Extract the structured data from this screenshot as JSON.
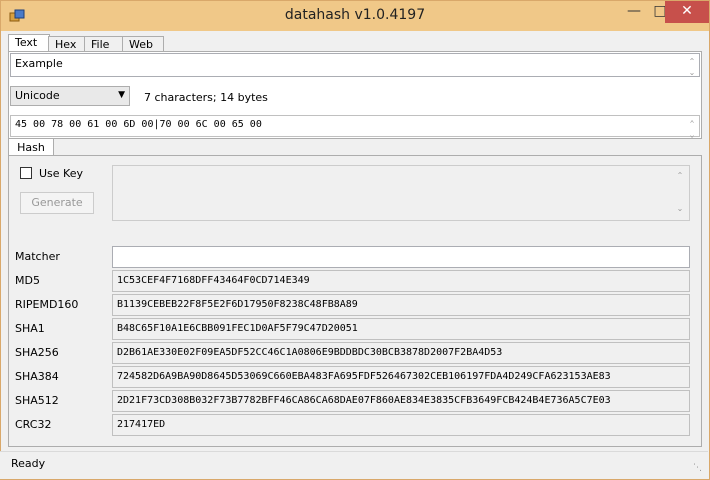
{
  "window": {
    "title": "datahash v1.0.4197"
  },
  "tabs": [
    "Text",
    "Hex",
    "File",
    "Web"
  ],
  "input": {
    "text": "Example"
  },
  "encoding": {
    "selected": "Unicode",
    "info": "7 characters; 14 bytes"
  },
  "hex": "45 00 78 00 61 00 6D 00|70 00 6C 00 65 00",
  "hash_tab": "Hash",
  "key": {
    "use_key_label": "Use Key",
    "generate_label": "Generate"
  },
  "hashes": [
    {
      "label": "Matcher",
      "value": ""
    },
    {
      "label": "MD5",
      "value": "1C53CEF4F7168DFF43464F0CD714E349"
    },
    {
      "label": "RIPEMD160",
      "value": "B1139CEBEB22F8F5E2F6D17950F8238C48FB8A89"
    },
    {
      "label": "SHA1",
      "value": "B48C65F10A1E6CBB091FEC1D0AF5F79C47D20051"
    },
    {
      "label": "SHA256",
      "value": "D2B61AE330E02F09EA5DF52CC46C1A0806E9BDDBDC30BCB3878D2007F2BA4D53"
    },
    {
      "label": "SHA384",
      "value": "724582D6A9BA90D8645D53069C660EBA483FA695FDF526467302CEB106197FDA4D249CFA623153AE83"
    },
    {
      "label": "SHA512",
      "value": "2D21F73CD308B032F73B7782BFF46CA86CA68DAE07F860AE834E3835CFB3649FCB424B4E736A5C7E03"
    },
    {
      "label": "CRC32",
      "value": "217417ED"
    }
  ],
  "status": {
    "text": "Ready"
  },
  "colors": {
    "titlebar": "#f0c888",
    "close": "#c7504b",
    "window_border": "#d9a86a"
  },
  "icons": {
    "app": "app-icon",
    "min": "minimize-icon",
    "max": "maximize-icon",
    "close": "close-icon"
  }
}
